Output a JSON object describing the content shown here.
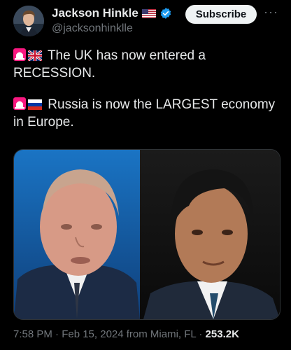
{
  "author": {
    "name": "Jackson Hinkle",
    "handle": "@jacksonhinklle"
  },
  "subscribe_label": "Subscribe",
  "more_label": "···",
  "tweet": {
    "line1": "The UK has now entered a RECESSION.",
    "line2": "Russia is now the LARGEST economy in Europe."
  },
  "meta": {
    "timestamp": "7:58 PM · Feb 15, 2024 from Miami, FL · ",
    "views": "253.2K"
  },
  "icons": [
    "us-flag-icon",
    "verified-badge-icon",
    "siren-icon",
    "uk-flag-icon",
    "russia-flag-icon",
    "more-icon"
  ],
  "colors": {
    "verified": "#1d9bf0",
    "muted": "#71767b",
    "text": "#e7e9ea",
    "background": "#000000"
  }
}
